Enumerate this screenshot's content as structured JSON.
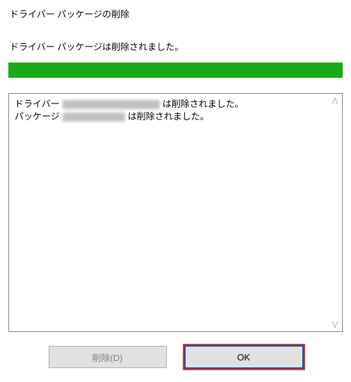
{
  "dialog": {
    "title": "ドライバー パッケージの削除",
    "status_message": "ドライバー パッケージは削除されました。"
  },
  "progress": {
    "percent": 100,
    "bar_color": "#17ab17"
  },
  "log": {
    "line1_prefix": "ドライバー",
    "line1_suffix": "は削除されました。",
    "line2_prefix": "パッケージ",
    "line2_suffix": "は削除されました。"
  },
  "buttons": {
    "delete_label": "削除(D)",
    "ok_label": "OK"
  },
  "scroll": {
    "up_glyph": "⋀",
    "down_glyph": "⋁"
  }
}
